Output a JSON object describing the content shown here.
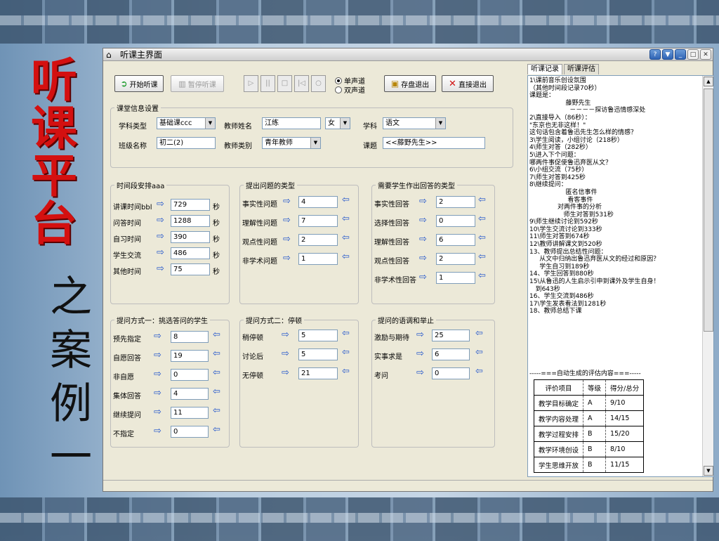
{
  "side": {
    "title_chars": [
      "听",
      "课",
      "平",
      "台"
    ],
    "subtitle_chars": [
      "之",
      "案",
      "例",
      "一"
    ]
  },
  "window": {
    "title": "听课主界面",
    "btn_help": "?",
    "btn_down": "▼",
    "btn_min": "_",
    "btn_max": "□",
    "btn_close": "✕"
  },
  "toolbar": {
    "start_label": "开始听课",
    "pause_label": "暂停听课",
    "media": [
      "▷",
      "||",
      "□",
      "|◁",
      "○"
    ],
    "mono_label": "单声道",
    "stereo_label": "双声道",
    "save_exit_label": "存盘退出",
    "direct_exit_label": "直接退出"
  },
  "classinfo": {
    "group": "课堂信息设置",
    "subject_type_label": "学科类型",
    "subject_type": "基础课ccc",
    "teacher_name_label": "教师姓名",
    "teacher_name": "江练",
    "gender": "女",
    "subject_label": "学科",
    "subject": "语文",
    "class_label": "班级名称",
    "class_name": "初二(2)",
    "teacher_type_label": "教师类别",
    "teacher_type": "青年教师",
    "topic_label": "课题",
    "topic": "<<藤野先生>>"
  },
  "time": {
    "group": "时间段安排aaa",
    "unit": "秒",
    "rows": [
      {
        "label": "讲课时间bbl",
        "value": "729"
      },
      {
        "label": "问答时间",
        "value": "1288"
      },
      {
        "label": "自习时间",
        "value": "390"
      },
      {
        "label": "学生交流",
        "value": "486"
      },
      {
        "label": "其他时间",
        "value": "75"
      }
    ]
  },
  "questions": {
    "group": "提出问题的类型",
    "rows": [
      {
        "label": "事实性问题",
        "value": "4"
      },
      {
        "label": "理解性问题",
        "value": "7"
      },
      {
        "label": "观点性问题",
        "value": "2"
      },
      {
        "label": "非学术问题",
        "value": "1"
      }
    ]
  },
  "answers": {
    "group": "需要学生作出回答的类型",
    "rows": [
      {
        "label": "事实性回答",
        "value": "2"
      },
      {
        "label": "选择性回答",
        "value": "0"
      },
      {
        "label": "理解性回答",
        "value": "6"
      },
      {
        "label": "观点性回答",
        "value": "2"
      },
      {
        "label": "非学术性回答",
        "value": "1"
      }
    ]
  },
  "method1": {
    "group": "提问方式一：挑选答问的学生",
    "rows": [
      {
        "label": "预先指定",
        "value": "8"
      },
      {
        "label": "自愿回答",
        "value": "19"
      },
      {
        "label": "非自愿",
        "value": "0"
      },
      {
        "label": "集体回答",
        "value": "4"
      },
      {
        "label": "继续提问",
        "value": "11"
      },
      {
        "label": "不指定",
        "value": "0"
      }
    ]
  },
  "method2": {
    "group": "提问方式二：停顿",
    "rows": [
      {
        "label": "稍停顿",
        "value": "5"
      },
      {
        "label": "讨论后",
        "value": "5"
      },
      {
        "label": "无停顿",
        "value": "21"
      }
    ]
  },
  "tone": {
    "group": "提问的语调和举止",
    "rows": [
      {
        "label": "激励与期待",
        "value": "25"
      },
      {
        "label": "实事求是",
        "value": "6"
      },
      {
        "label": "考问",
        "value": "0"
      }
    ]
  },
  "log_panel": {
    "tab_record": "听课记录",
    "tab_eval": "听课评估",
    "lines": [
      "1\\课前音乐创设氛围",
      "（其他时间段记录70秒）",
      "课题是：",
      "                  藤野先生",
      "                    －－－－探访鲁迅情感深处",
      "2\\直接导入（86秒）：",
      "\"东京也无非这样！\"",
      "这句话包含着鲁迅先生怎么样的情感？",
      "3\\学生阅读，小组讨论（218秒）",
      "4\\师生对答（282秒）",
      "5\\进入下个问题：",
      "哪两件事促使鲁迅弃医从文？",
      "6\\小组交流（75秒）",
      "7\\师生对答到425秒",
      "8\\继续提问：",
      "                  匿名信事件",
      "                   看客事件",
      "              对两件事的分析",
      "                 师生对答到531秒",
      "9\\师生继续讨论到592秒",
      "10\\学生交流讨论到333秒",
      "11\\师生对答到674秒",
      "12\\教师讲解课文到520秒",
      "13、教师提出总结性问题：",
      "     从文中归纳出鲁迅弃医从文的经过和原因？",
      "     学生自习到189秒",
      "14、学生回答到880秒",
      "15\\从鲁迅的人生启示引申到课外及学生自身！",
      "   到643秒",
      "16、学生交流到486秒",
      "17\\学生发表看法到1281秒",
      "18、教师总结下课"
    ],
    "eval_title": "-----===自动生成的评估内容===-----",
    "eval_header": [
      "评价项目",
      "等级",
      "得分/总分"
    ],
    "eval_rows": [
      [
        "教学目标确定",
        "A",
        "9/10"
      ],
      [
        "教学内容处理",
        "A",
        "14/15"
      ],
      [
        "教学过程安排",
        "B",
        "15/20"
      ],
      [
        "教学环境创设",
        "B",
        "8/10"
      ],
      [
        "学生思维开放",
        "B",
        "11/15"
      ]
    ]
  },
  "icons": {
    "arrow_right": "⇨",
    "arrow_left": "⇦"
  }
}
